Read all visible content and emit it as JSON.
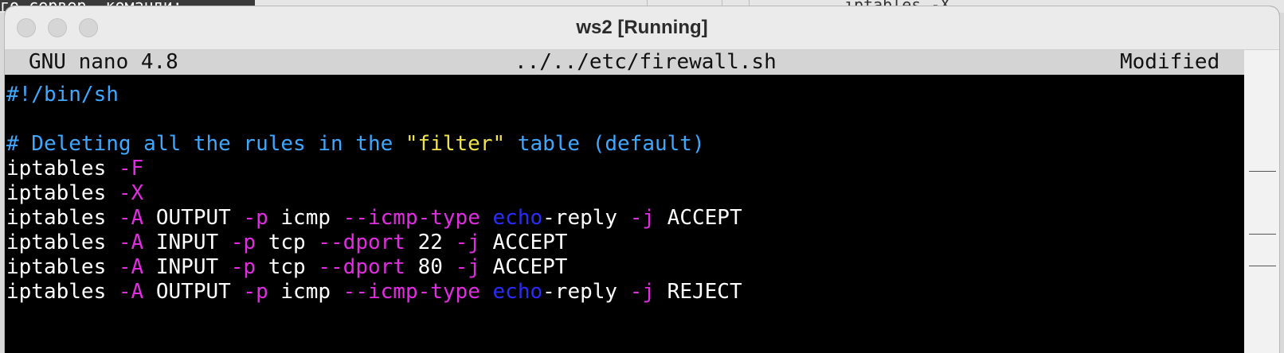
{
  "background": {
    "left_text": "го сервер, команди:",
    "right_text": "iptables -X"
  },
  "window": {
    "title": "ws2 [Running]"
  },
  "nano": {
    "version": "GNU nano 4.8",
    "filename": "../../etc/firewall.sh",
    "status": "Modified"
  },
  "editor": {
    "lines": [
      [
        {
          "t": "#!/bin/sh",
          "c": "comment"
        }
      ],
      [],
      [
        {
          "t": "# Deleting all the rules in the ",
          "c": "comment"
        },
        {
          "t": "\"filter\"",
          "c": "string"
        },
        {
          "t": " table (default)",
          "c": "comment"
        }
      ],
      [
        {
          "t": "iptables ",
          "c": "plain"
        },
        {
          "t": "-F",
          "c": "flag"
        }
      ],
      [
        {
          "t": "iptables ",
          "c": "plain"
        },
        {
          "t": "-X",
          "c": "flag"
        }
      ],
      [
        {
          "t": "iptables ",
          "c": "plain"
        },
        {
          "t": "-A",
          "c": "flag"
        },
        {
          "t": " OUTPUT ",
          "c": "plain"
        },
        {
          "t": "-p",
          "c": "flag"
        },
        {
          "t": " icmp ",
          "c": "plain"
        },
        {
          "t": "--icmp-type",
          "c": "flag"
        },
        {
          "t": " ",
          "c": "plain"
        },
        {
          "t": "echo",
          "c": "kw"
        },
        {
          "t": "-reply ",
          "c": "plain"
        },
        {
          "t": "-j",
          "c": "flag"
        },
        {
          "t": " ACCEPT",
          "c": "plain"
        }
      ],
      [
        {
          "t": "iptables ",
          "c": "plain"
        },
        {
          "t": "-A",
          "c": "flag"
        },
        {
          "t": " INPUT ",
          "c": "plain"
        },
        {
          "t": "-p",
          "c": "flag"
        },
        {
          "t": " tcp ",
          "c": "plain"
        },
        {
          "t": "--dport",
          "c": "flag"
        },
        {
          "t": " 22 ",
          "c": "plain"
        },
        {
          "t": "-j",
          "c": "flag"
        },
        {
          "t": " ACCEPT",
          "c": "plain"
        }
      ],
      [
        {
          "t": "iptables ",
          "c": "plain"
        },
        {
          "t": "-A",
          "c": "flag"
        },
        {
          "t": " INPUT ",
          "c": "plain"
        },
        {
          "t": "-p",
          "c": "flag"
        },
        {
          "t": " tcp ",
          "c": "plain"
        },
        {
          "t": "--dport",
          "c": "flag"
        },
        {
          "t": " 80 ",
          "c": "plain"
        },
        {
          "t": "-j",
          "c": "flag"
        },
        {
          "t": " ACCEPT",
          "c": "plain"
        }
      ],
      [
        {
          "t": "iptables ",
          "c": "plain"
        },
        {
          "t": "-A",
          "c": "flag"
        },
        {
          "t": " OUTPUT ",
          "c": "plain"
        },
        {
          "t": "-p",
          "c": "flag"
        },
        {
          "t": " icmp ",
          "c": "plain"
        },
        {
          "t": "--icmp-type",
          "c": "flag"
        },
        {
          "t": " ",
          "c": "plain"
        },
        {
          "t": "echo",
          "c": "kw"
        },
        {
          "t": "-reply ",
          "c": "plain"
        },
        {
          "t": "-j",
          "c": "flag"
        },
        {
          "t": " REJECT",
          "c": "plain"
        }
      ]
    ]
  },
  "colors": {
    "comment": "#3ea8ff",
    "string": "#f0e24b",
    "flag": "#e22ce2",
    "keyword": "#2b2bff",
    "plain": "#ffffff"
  }
}
